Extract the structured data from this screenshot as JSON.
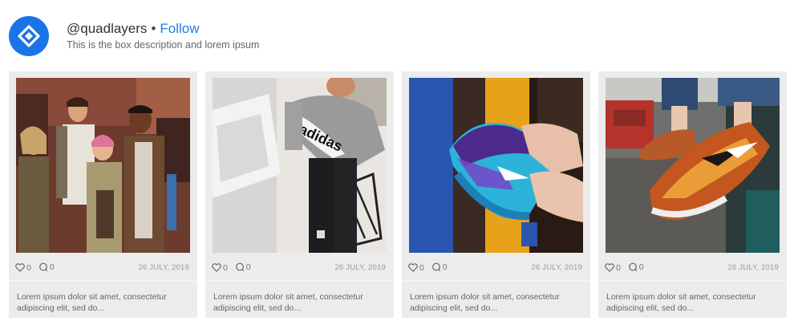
{
  "profile": {
    "username": "@quadlayers",
    "separator": "•",
    "follow_label": "Follow",
    "description": "This is the box description and lorem ipsum",
    "avatar_icon": "quadlayers-logo-icon",
    "accent_color": "#1a73e8"
  },
  "posts": [
    {
      "image": "friends-group-photo",
      "likes": "0",
      "comments": "0",
      "date": "26 JULY, 2019",
      "caption": "Lorem ipsum dolor sit amet, consectetur adipiscing elit, sed do..."
    },
    {
      "image": "adidas-sweater-photo",
      "likes": "0",
      "comments": "0",
      "date": "26 JULY, 2019",
      "caption": "Lorem ipsum dolor sit amet, consectetur adipiscing elit, sed do..."
    },
    {
      "image": "blue-sneaker-photo",
      "likes": "0",
      "comments": "0",
      "date": "26 JULY, 2019",
      "caption": "Lorem ipsum dolor sit amet, consectetur adipiscing elit, sed do..."
    },
    {
      "image": "galaxy-shoe-photo",
      "likes": "0",
      "comments": "0",
      "date": "26 JULY, 2019",
      "caption": "Lorem ipsum dolor sit amet, consectetur adipiscing elit, sed do..."
    }
  ]
}
